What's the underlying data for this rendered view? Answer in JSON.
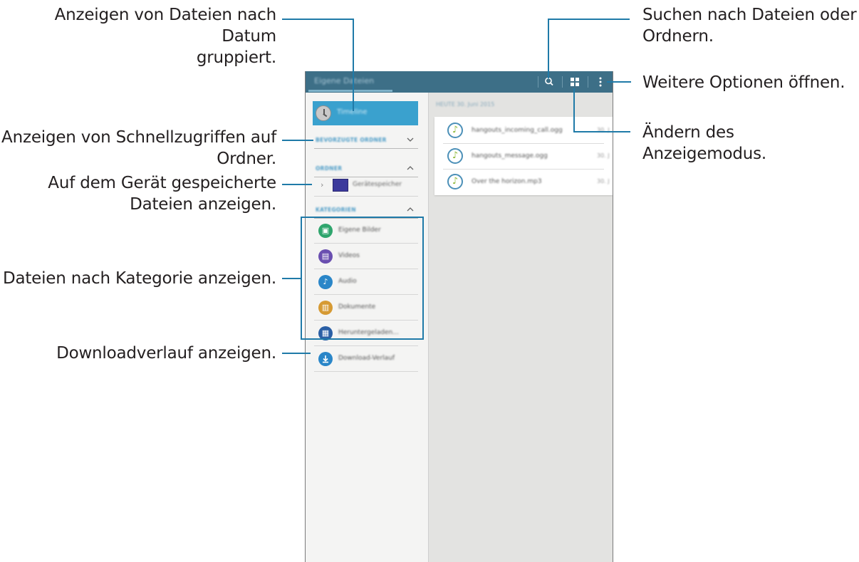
{
  "callouts": {
    "group_by_date": [
      "Anzeigen von Dateien nach Datum",
      "gruppiert."
    ],
    "quick_access": [
      "Anzeigen von Schnellzugriffen auf",
      "Ordner."
    ],
    "device_files": [
      "Auf dem Gerät gespeicherte",
      "Dateien anzeigen."
    ],
    "by_category": "Dateien nach Kategorie anzeigen.",
    "download_history": "Downloadverlauf anzeigen.",
    "search": [
      "Suchen nach Dateien oder",
      "Ordnern."
    ],
    "more_options": "Weitere Optionen öffnen.",
    "view_mode": "Ändern des Anzeigemodus."
  },
  "app": {
    "title": "Eigene Dateien",
    "timeline_label": "Timeline",
    "section_favorites": "BEVORZUGTE ORDNER",
    "section_folders": "ORDNER",
    "storage_label": "Gerätespeicher",
    "section_categories": "KATEGORIEN",
    "categories": [
      {
        "label": "Eigene Bilder",
        "color": "#2fa56d",
        "icon": "image-icon",
        "glyph": "▣"
      },
      {
        "label": "Videos",
        "color": "#6a4fb0",
        "icon": "video-icon",
        "glyph": "▤"
      },
      {
        "label": "Audio",
        "color": "#2a86c8",
        "icon": "music-note-icon",
        "glyph": "♪"
      },
      {
        "label": "Dokumente",
        "color": "#d69a33",
        "icon": "document-icon",
        "glyph": "▥"
      },
      {
        "label": "Heruntergeladen...",
        "color": "#2a5fa5",
        "icon": "apps-icon",
        "glyph": "▦"
      }
    ],
    "download_history_label": "Download-Verlauf",
    "download_color": "#2a86c8",
    "date_header": "HEUTE   30. Juni 2015",
    "files": [
      {
        "name": "hangouts_incoming_call.ogg",
        "meta": "30. J"
      },
      {
        "name": "hangouts_message.ogg",
        "meta": "30. J"
      },
      {
        "name": "Over the horizon.mp3",
        "meta": "30. J"
      }
    ]
  }
}
